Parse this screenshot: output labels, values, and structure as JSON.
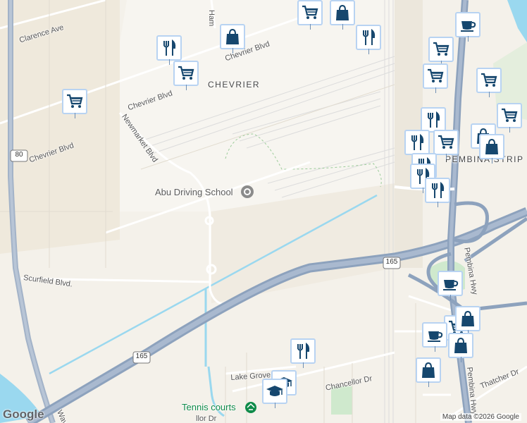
{
  "map": {
    "areas": {
      "chevrier": "CHEVRIER",
      "pembina_strip": "PEMBINA STRIP"
    },
    "streets": {
      "clarence_ave": "Clarence Ave",
      "chevrier_blvd_1": "Chevrier Blvd",
      "chevrier_blvd_2": "Chevrier Blvd",
      "chevrier_blvd_3": "Chevrier Blvd",
      "newmarket_blvd": "Newmarket Blvd",
      "scurfield_blvd": "Scurfield Blvd.",
      "lake_grove_bay": "Lake Grove Bay",
      "chancellor_dr": "Chancellor Dr",
      "thatcher_dr": "Thatcher Dr",
      "pembina_hwy": "Pembina Hwy",
      "waverley": "Wav",
      "chancellor_dr_partial": "llor Dr",
      "ham": "Ham"
    },
    "routes": {
      "route_80": "80",
      "route_165_a": "165",
      "route_165_b": "165"
    },
    "pois": {
      "abu_driving_school": "Abu Driving School",
      "tennis_courts": "Tennis courts"
    },
    "icons": {
      "shopping_cart": "shopping-cart-icon",
      "shopping_bag": "shopping-bag-icon",
      "restaurant": "restaurant-icon",
      "cafe": "coffee-cup-icon",
      "school": "graduation-cap-icon"
    },
    "colors": {
      "pin_icon": "#16476e",
      "pin_border": "#b8d3f2",
      "highway": "#8da2bd",
      "water": "#9ad8ef",
      "park": "#cfe9cd"
    },
    "attribution": "Map data ©2026 Google",
    "logo": "Google"
  }
}
